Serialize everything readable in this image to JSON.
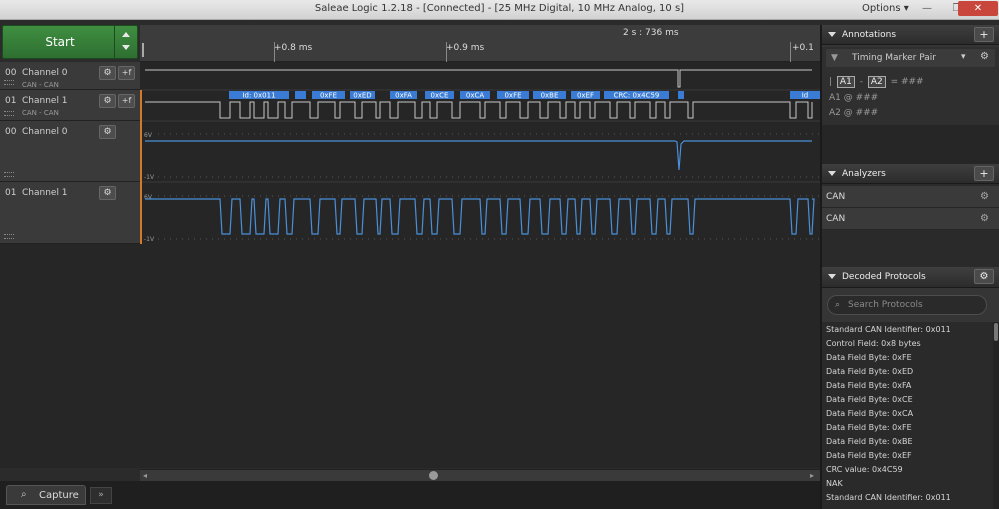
{
  "window": {
    "title": "Saleae Logic 1.2.18 - [Connected] - [25 MHz Digital, 10 MHz Analog, 10 s]",
    "options_label": "Options ▾",
    "minimize_glyph": "—",
    "maximize_glyph": "❒",
    "close_glyph": "✕"
  },
  "controls": {
    "start_label": "Start"
  },
  "channels": [
    {
      "num": "00",
      "name": "Channel 0",
      "sub": "CAN - CAN"
    },
    {
      "num": "01",
      "name": "Channel 1",
      "sub": "CAN - CAN"
    },
    {
      "num": "00",
      "name": "Channel 0",
      "sub": ""
    },
    {
      "num": "01",
      "name": "Channel 1",
      "sub": ""
    }
  ],
  "channel_button_glyphs": {
    "gear": "⚙",
    "ext": "+f"
  },
  "timeline": {
    "absolute_time": "2 s : 736 ms",
    "ticks": [
      "+0.8 ms",
      "+0.9 ms",
      "+0.1"
    ]
  },
  "waveform": {
    "frame_labels": [
      "Id: 0x011",
      "",
      "0xFE",
      "0xED",
      "0xFA",
      "0xCE",
      "0xCA",
      "0xFE",
      "0xBE",
      "0xEF",
      "CRC: 0x4C59",
      "",
      "Id"
    ],
    "analog_top_label": "6V",
    "analog_bottom_label": "-1V",
    "trace_color": "#4a90d9",
    "frame_color": "#3a7bd5"
  },
  "annotations": {
    "header": "Annotations",
    "add_glyph": "+",
    "marker_pair": "Timing Marker Pair",
    "a1": "A1",
    "a2": "A2",
    "separator": "-",
    "eq": "= ###",
    "line_a1": "A1  @  ###",
    "line_a2": "A2  @  ###"
  },
  "analyzers": {
    "header": "Analyzers",
    "add_glyph": "+",
    "items": [
      "CAN",
      "CAN"
    ]
  },
  "decoded": {
    "header": "Decoded Protocols",
    "search_placeholder": "Search Protocols",
    "items": [
      "Standard CAN Identifier: 0x011",
      "Control Field: 0x8 bytes",
      "Data Field Byte: 0xFE",
      "Data Field Byte: 0xED",
      "Data Field Byte: 0xFA",
      "Data Field Byte: 0xCE",
      "Data Field Byte: 0xCA",
      "Data Field Byte: 0xFE",
      "Data Field Byte: 0xBE",
      "Data Field Byte: 0xEF",
      "CRC value: 0x4C59",
      "NAK",
      "Standard CAN Identifier: 0x011"
    ]
  },
  "bottom": {
    "capture_label": "Capture",
    "more_glyph": "»"
  }
}
